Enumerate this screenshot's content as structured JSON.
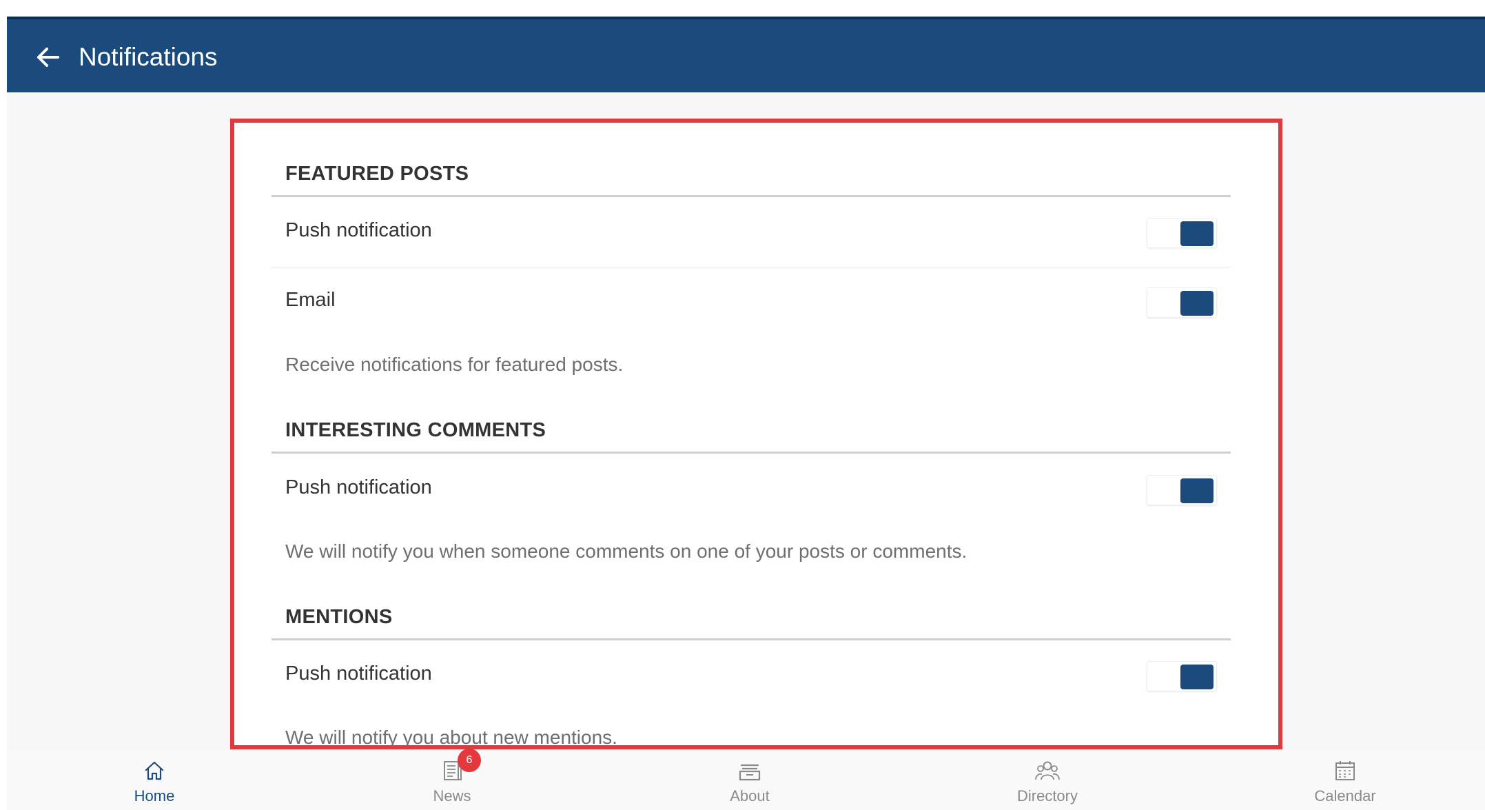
{
  "header": {
    "title": "Notifications",
    "back_icon": "arrow-left-icon"
  },
  "sections": [
    {
      "title": "FEATURED POSTS",
      "rows": [
        {
          "label": "Push notification",
          "enabled": true
        },
        {
          "label": "Email",
          "enabled": true
        }
      ],
      "description": "Receive notifications for featured posts."
    },
    {
      "title": "INTERESTING COMMENTS",
      "rows": [
        {
          "label": "Push notification",
          "enabled": true
        }
      ],
      "description": "We will notify you when someone comments on one of your posts or comments."
    },
    {
      "title": "MENTIONS",
      "rows": [
        {
          "label": "Push notification",
          "enabled": true
        }
      ],
      "description": "We will notify you about new mentions."
    }
  ],
  "bottom_nav": {
    "items": [
      {
        "label": "Home",
        "icon": "home-icon",
        "active": true
      },
      {
        "label": "News",
        "icon": "news-icon",
        "active": false,
        "badge": "6"
      },
      {
        "label": "About",
        "icon": "about-icon",
        "active": false
      },
      {
        "label": "Directory",
        "icon": "directory-icon",
        "active": false
      },
      {
        "label": "Calendar",
        "icon": "calendar-icon",
        "active": false
      }
    ]
  },
  "colors": {
    "header_bg": "#1b4b7c",
    "toggle_on": "#1b4b7c",
    "highlight_border": "#e4383d",
    "badge": "#e4383d"
  }
}
